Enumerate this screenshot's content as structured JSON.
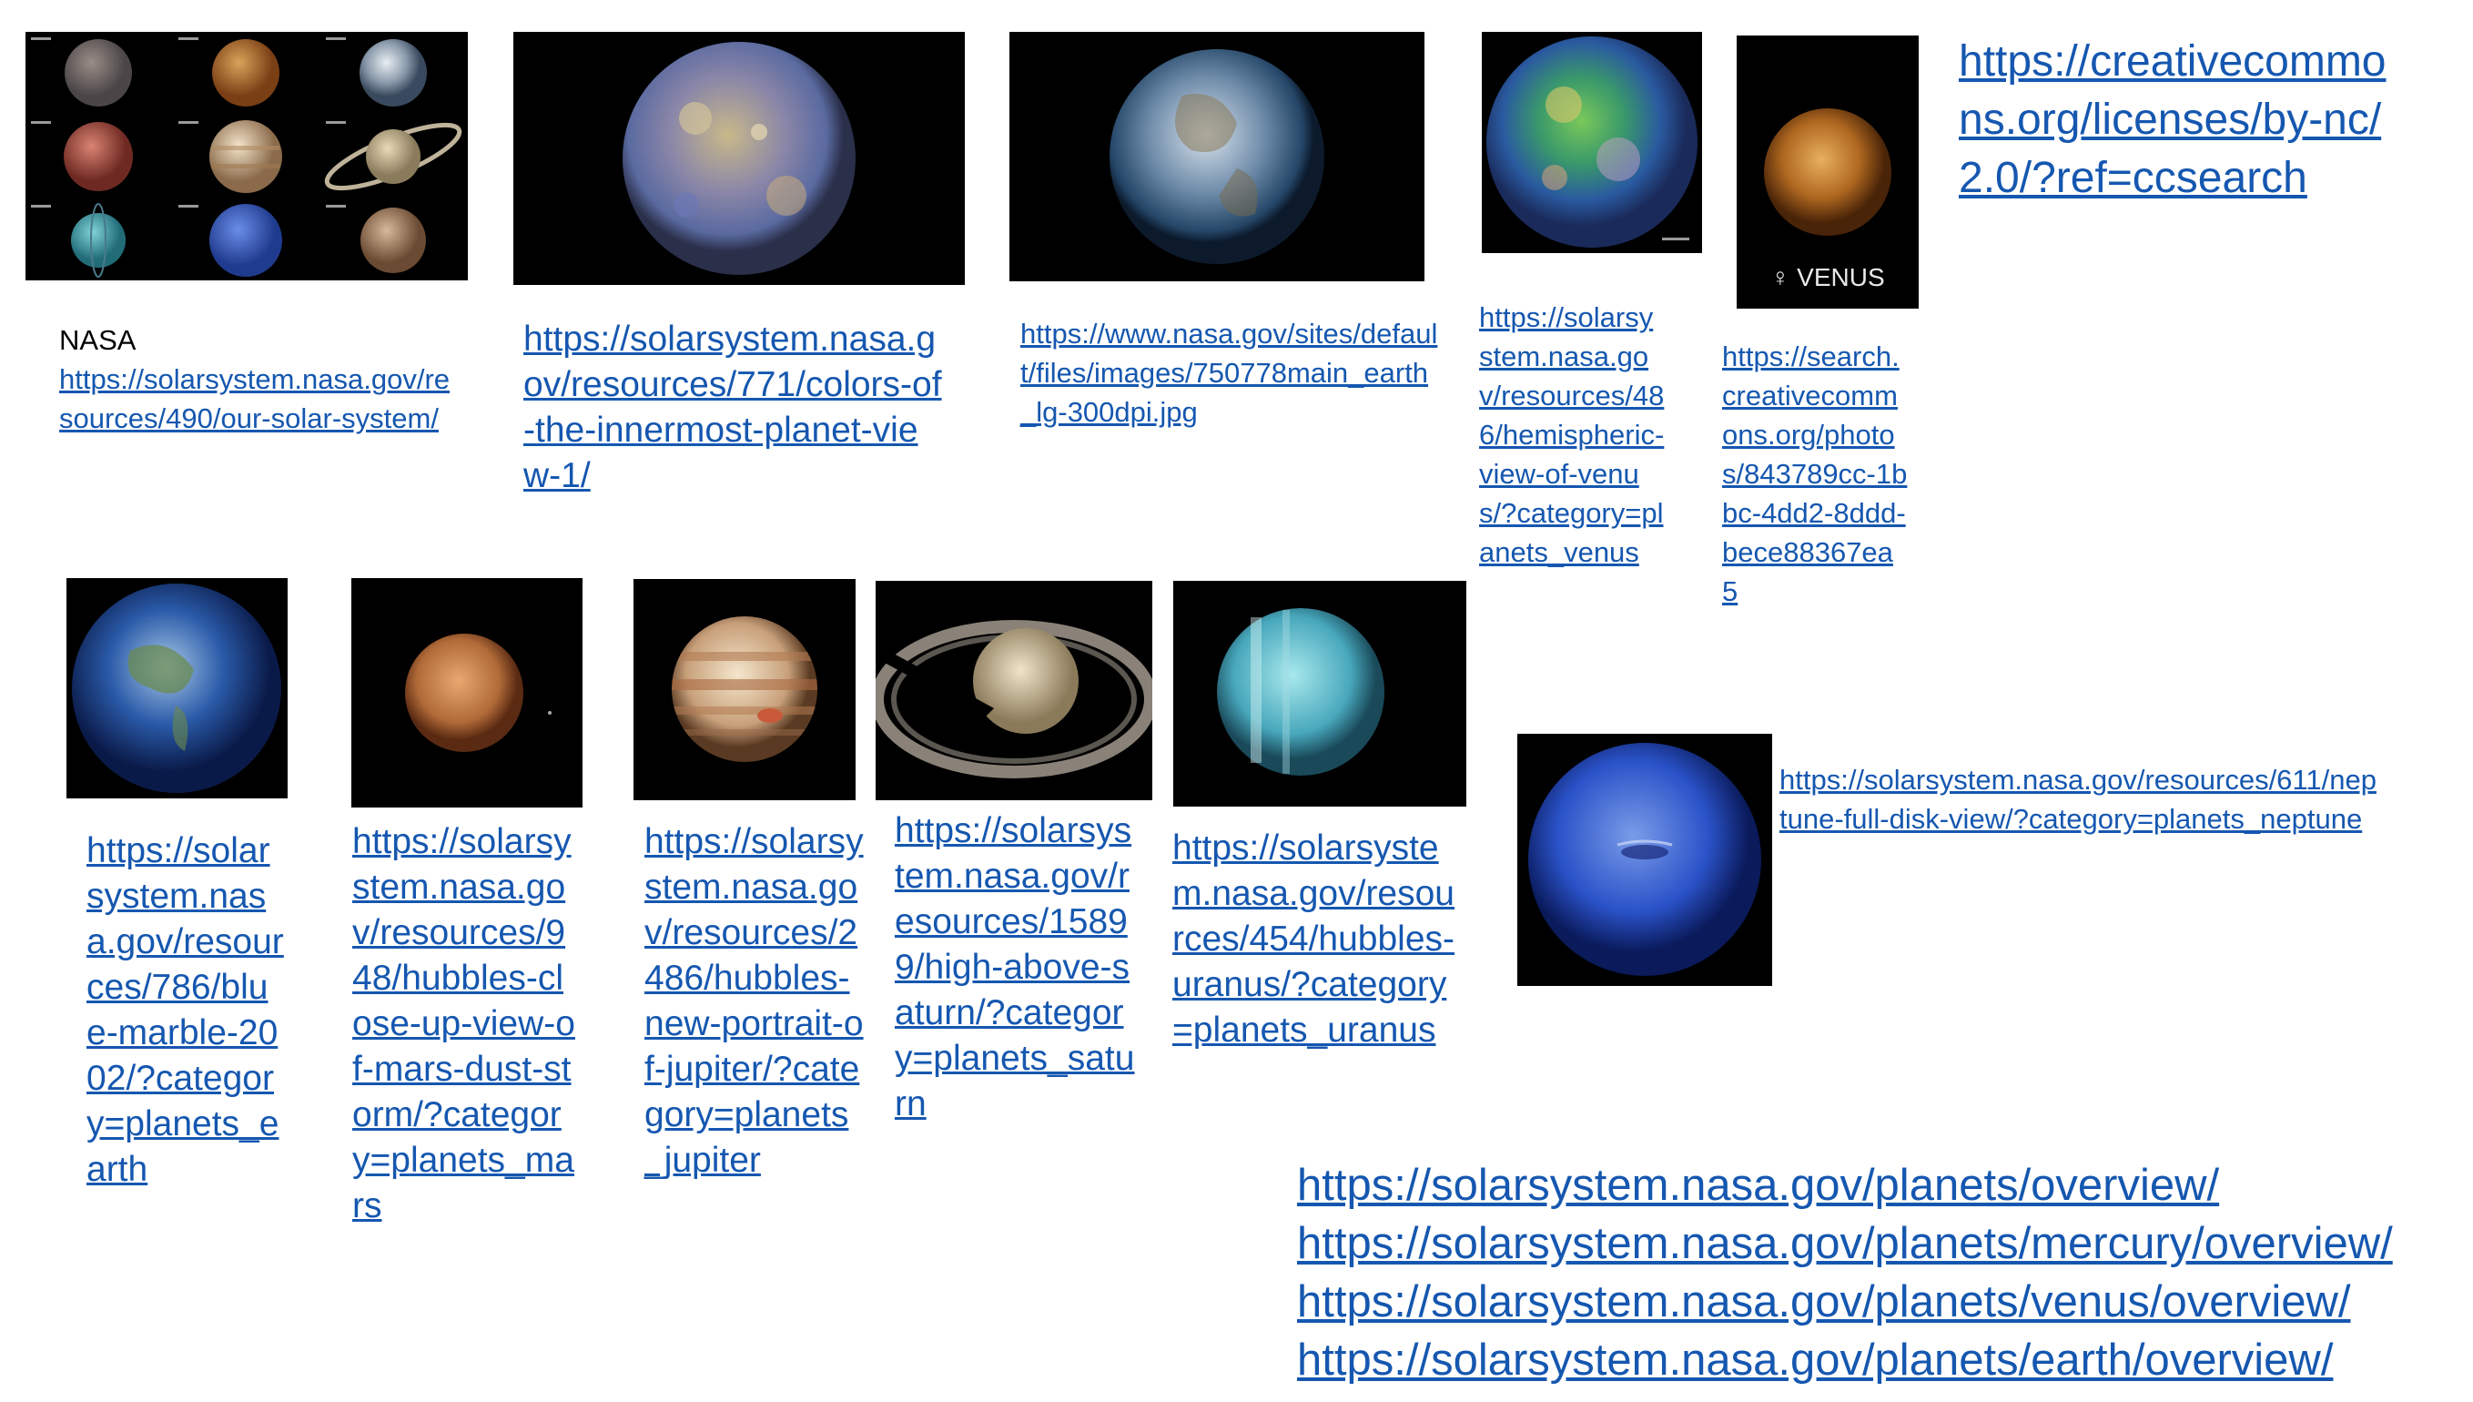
{
  "credit": {
    "source": "NASA",
    "our_solar_system_url": "https://solarsystem.nasa.gov/resources/490/our-solar-system/"
  },
  "links": {
    "mercury": "https://solarsystem.nasa.gov/resources/771/colors-of-the-innermost-planet-view-1/",
    "earth_main": "https://www.nasa.gov/sites/default/files/images/750778main_earth_lg-300dpi.jpg",
    "venus_nasa": "https://solarsystem.nasa.gov/resources/486/hemispheric-view-of-venus/?category=planets_venus",
    "venus_cc": "https://search.creativecommons.org/photos/843789cc-1bbc-4dd2-8ddd-bece88367ea5",
    "license": "https://creativecommons.org/licenses/by-nc/2.0/?ref=ccsearch",
    "earth_blue_marble": "https://solarsystem.nasa.gov/resources/786/blue-marble-2002/?category=planets_earth",
    "mars": "https://solarsystem.nasa.gov/resources/948/hubbles-close-up-view-of-mars-dust-storm/?category=planets_mars",
    "jupiter": "https://solarsystem.nasa.gov/resources/2486/hubbles-new-portrait-of-jupiter/?category=planets_jupiter",
    "saturn": "https://solarsystem.nasa.gov/resources/15899/high-above-saturn/?category=planets_saturn",
    "uranus": "https://solarsystem.nasa.gov/resources/454/hubbles-uranus/?category=planets_uranus",
    "neptune": "https://solarsystem.nasa.gov/resources/611/neptune-full-disk-view/?category=planets_neptune"
  },
  "overview_links": [
    "https://solarsystem.nasa.gov/planets/overview/",
    "https://solarsystem.nasa.gov/planets/mercury/overview/",
    "https://solarsystem.nasa.gov/planets/venus/overview/",
    "https://solarsystem.nasa.gov/planets/earth/overview/"
  ],
  "venus_poster_caption": "♀ VENUS",
  "colors": {
    "link": "#1557b0",
    "background": "#ffffff",
    "image_background": "#000000"
  }
}
